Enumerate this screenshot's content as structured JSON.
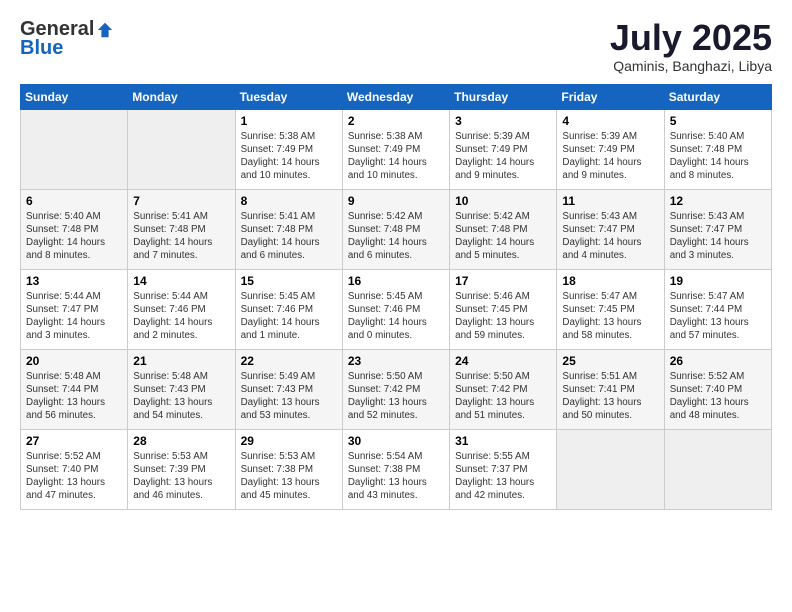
{
  "header": {
    "logo_general": "General",
    "logo_blue": "Blue",
    "month_title": "July 2025",
    "location": "Qaminis, Banghazi, Libya"
  },
  "weekdays": [
    "Sunday",
    "Monday",
    "Tuesday",
    "Wednesday",
    "Thursday",
    "Friday",
    "Saturday"
  ],
  "weeks": [
    [
      {
        "day": "",
        "text": "",
        "empty": true
      },
      {
        "day": "",
        "text": "",
        "empty": true
      },
      {
        "day": "1",
        "text": "Sunrise: 5:38 AM\nSunset: 7:49 PM\nDaylight: 14 hours and 10 minutes.",
        "empty": false
      },
      {
        "day": "2",
        "text": "Sunrise: 5:38 AM\nSunset: 7:49 PM\nDaylight: 14 hours and 10 minutes.",
        "empty": false
      },
      {
        "day": "3",
        "text": "Sunrise: 5:39 AM\nSunset: 7:49 PM\nDaylight: 14 hours and 9 minutes.",
        "empty": false
      },
      {
        "day": "4",
        "text": "Sunrise: 5:39 AM\nSunset: 7:49 PM\nDaylight: 14 hours and 9 minutes.",
        "empty": false
      },
      {
        "day": "5",
        "text": "Sunrise: 5:40 AM\nSunset: 7:48 PM\nDaylight: 14 hours and 8 minutes.",
        "empty": false
      }
    ],
    [
      {
        "day": "6",
        "text": "Sunrise: 5:40 AM\nSunset: 7:48 PM\nDaylight: 14 hours and 8 minutes.",
        "empty": false
      },
      {
        "day": "7",
        "text": "Sunrise: 5:41 AM\nSunset: 7:48 PM\nDaylight: 14 hours and 7 minutes.",
        "empty": false
      },
      {
        "day": "8",
        "text": "Sunrise: 5:41 AM\nSunset: 7:48 PM\nDaylight: 14 hours and 6 minutes.",
        "empty": false
      },
      {
        "day": "9",
        "text": "Sunrise: 5:42 AM\nSunset: 7:48 PM\nDaylight: 14 hours and 6 minutes.",
        "empty": false
      },
      {
        "day": "10",
        "text": "Sunrise: 5:42 AM\nSunset: 7:48 PM\nDaylight: 14 hours and 5 minutes.",
        "empty": false
      },
      {
        "day": "11",
        "text": "Sunrise: 5:43 AM\nSunset: 7:47 PM\nDaylight: 14 hours and 4 minutes.",
        "empty": false
      },
      {
        "day": "12",
        "text": "Sunrise: 5:43 AM\nSunset: 7:47 PM\nDaylight: 14 hours and 3 minutes.",
        "empty": false
      }
    ],
    [
      {
        "day": "13",
        "text": "Sunrise: 5:44 AM\nSunset: 7:47 PM\nDaylight: 14 hours and 3 minutes.",
        "empty": false
      },
      {
        "day": "14",
        "text": "Sunrise: 5:44 AM\nSunset: 7:46 PM\nDaylight: 14 hours and 2 minutes.",
        "empty": false
      },
      {
        "day": "15",
        "text": "Sunrise: 5:45 AM\nSunset: 7:46 PM\nDaylight: 14 hours and 1 minute.",
        "empty": false
      },
      {
        "day": "16",
        "text": "Sunrise: 5:45 AM\nSunset: 7:46 PM\nDaylight: 14 hours and 0 minutes.",
        "empty": false
      },
      {
        "day": "17",
        "text": "Sunrise: 5:46 AM\nSunset: 7:45 PM\nDaylight: 13 hours and 59 minutes.",
        "empty": false
      },
      {
        "day": "18",
        "text": "Sunrise: 5:47 AM\nSunset: 7:45 PM\nDaylight: 13 hours and 58 minutes.",
        "empty": false
      },
      {
        "day": "19",
        "text": "Sunrise: 5:47 AM\nSunset: 7:44 PM\nDaylight: 13 hours and 57 minutes.",
        "empty": false
      }
    ],
    [
      {
        "day": "20",
        "text": "Sunrise: 5:48 AM\nSunset: 7:44 PM\nDaylight: 13 hours and 56 minutes.",
        "empty": false
      },
      {
        "day": "21",
        "text": "Sunrise: 5:48 AM\nSunset: 7:43 PM\nDaylight: 13 hours and 54 minutes.",
        "empty": false
      },
      {
        "day": "22",
        "text": "Sunrise: 5:49 AM\nSunset: 7:43 PM\nDaylight: 13 hours and 53 minutes.",
        "empty": false
      },
      {
        "day": "23",
        "text": "Sunrise: 5:50 AM\nSunset: 7:42 PM\nDaylight: 13 hours and 52 minutes.",
        "empty": false
      },
      {
        "day": "24",
        "text": "Sunrise: 5:50 AM\nSunset: 7:42 PM\nDaylight: 13 hours and 51 minutes.",
        "empty": false
      },
      {
        "day": "25",
        "text": "Sunrise: 5:51 AM\nSunset: 7:41 PM\nDaylight: 13 hours and 50 minutes.",
        "empty": false
      },
      {
        "day": "26",
        "text": "Sunrise: 5:52 AM\nSunset: 7:40 PM\nDaylight: 13 hours and 48 minutes.",
        "empty": false
      }
    ],
    [
      {
        "day": "27",
        "text": "Sunrise: 5:52 AM\nSunset: 7:40 PM\nDaylight: 13 hours and 47 minutes.",
        "empty": false
      },
      {
        "day": "28",
        "text": "Sunrise: 5:53 AM\nSunset: 7:39 PM\nDaylight: 13 hours and 46 minutes.",
        "empty": false
      },
      {
        "day": "29",
        "text": "Sunrise: 5:53 AM\nSunset: 7:38 PM\nDaylight: 13 hours and 45 minutes.",
        "empty": false
      },
      {
        "day": "30",
        "text": "Sunrise: 5:54 AM\nSunset: 7:38 PM\nDaylight: 13 hours and 43 minutes.",
        "empty": false
      },
      {
        "day": "31",
        "text": "Sunrise: 5:55 AM\nSunset: 7:37 PM\nDaylight: 13 hours and 42 minutes.",
        "empty": false
      },
      {
        "day": "",
        "text": "",
        "empty": true
      },
      {
        "day": "",
        "text": "",
        "empty": true
      }
    ]
  ]
}
